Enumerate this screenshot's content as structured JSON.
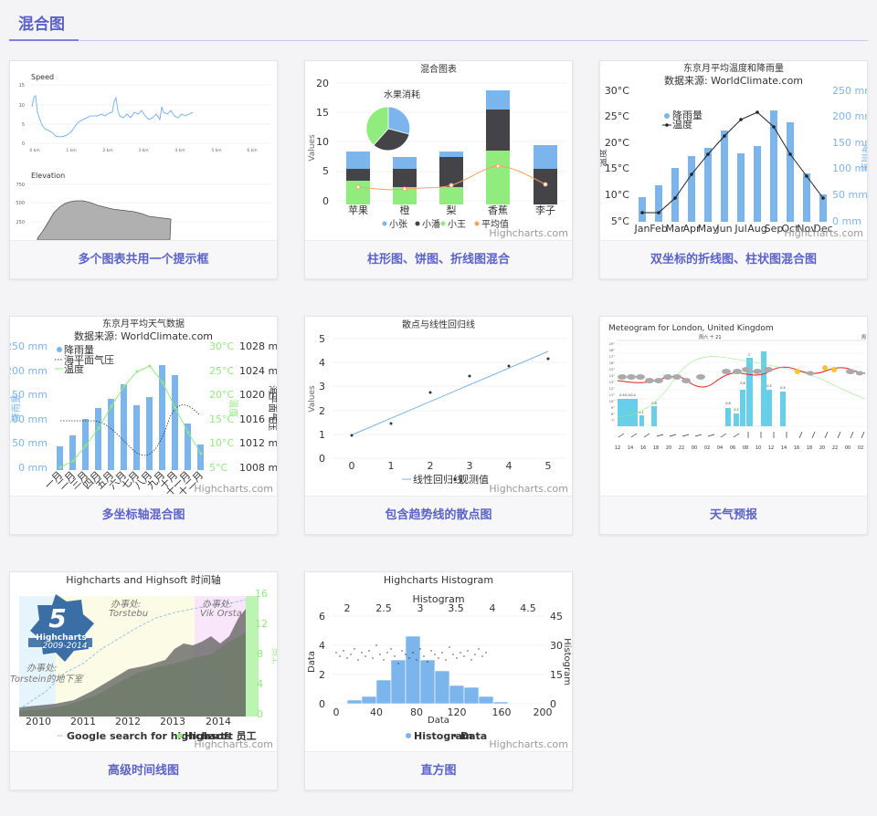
{
  "page": {
    "title": "混合图"
  },
  "colors": {
    "accent": "#5b62c8",
    "blue": "#7cb5ec",
    "dark": "#434348",
    "green": "#90ed7d",
    "orange": "#f7a35c"
  },
  "cards": [
    {
      "caption": "多个图表共用一个提示框",
      "thumb": {
        "speed_title": "Speed",
        "speed_yticks": [
          "15",
          "10",
          "5",
          "0"
        ],
        "elevation_title": "Elevation",
        "elevation_yticks": [
          "750",
          "500",
          "250"
        ],
        "xticks": [
          "0 km",
          "1 km",
          "2 km",
          "3 km",
          "4 km",
          "5 km",
          "6 km"
        ]
      }
    },
    {
      "caption": "柱形图、饼图、折线图混合",
      "thumb": {
        "title": "混合图表",
        "pie_title": "水果消耗",
        "ylabel": "Values",
        "yticks": [
          "20",
          "15",
          "10",
          "5",
          "0"
        ],
        "categories": [
          "苹果",
          "橙",
          "梨",
          "香蕉",
          "李子"
        ],
        "legend": [
          "小张",
          "小潘",
          "小王",
          "平均值"
        ],
        "credit": "Highcharts.com"
      }
    },
    {
      "caption": "双坐标的折线图、柱状图混合图",
      "thumb": {
        "title": "东京月平均温度和降雨量",
        "subtitle": "数据来源: WorldClimate.com",
        "left_ticks": [
          "30°C",
          "25°C",
          "20°C",
          "15°C",
          "10°C",
          "5°C"
        ],
        "right_ticks": [
          "250 mm",
          "200 mm",
          "150 mm",
          "100 mm",
          "50 mm",
          "0 mm"
        ],
        "left_axis_title": "温度",
        "right_axis_title": "降雨量",
        "legend": [
          "降雨量",
          "温度"
        ],
        "months": [
          "Jan",
          "Feb",
          "Mar",
          "Apr",
          "May",
          "Jun",
          "Jul",
          "Aug",
          "Sep",
          "Oct",
          "Nov",
          "Dec"
        ],
        "credit": "Highcharts.com"
      }
    },
    {
      "caption": "多坐标轴混合图",
      "thumb": {
        "title": "东京月平均天气数据",
        "subtitle": "数据来源: WorldClimate.com",
        "left_ticks": [
          "250 mm",
          "200 mm",
          "150 mm",
          "100 mm",
          "50 mm",
          "0 mm"
        ],
        "temp_ticks": [
          "30°C",
          "25°C",
          "20°C",
          "15°C",
          "10°C",
          "5°C"
        ],
        "press_ticks": [
          "1028 m",
          "1024 m",
          "1020 m",
          "1016 m",
          "1012 m",
          "1008 m"
        ],
        "left_axis_title": "降雨量",
        "temp_axis_title": "温度",
        "press_axis_title": "海平面气压",
        "legend": [
          "降雨量",
          "海平面气压",
          "温度"
        ],
        "months": [
          "一月",
          "二月",
          "三月",
          "四月",
          "五月",
          "六月",
          "七月",
          "八月",
          "九月",
          "十月",
          "十一月",
          "十二月"
        ],
        "credit": "Highcharts.com"
      }
    },
    {
      "caption": "包含趋势线的散点图",
      "thumb": {
        "title": "散点与线性回归线",
        "ylabel": "Values",
        "yticks": [
          "5",
          "4",
          "3",
          "2",
          "1",
          "0"
        ],
        "xticks": [
          "0",
          "1",
          "2",
          "3",
          "4",
          "5"
        ],
        "legend": [
          "线性回归线",
          "观测值"
        ],
        "credit": "Highcharts.com"
      }
    },
    {
      "caption": "天气预报",
      "thumb": {
        "title": "Meteogram for London, United Kingdom",
        "day_label": "周六 十 21",
        "day_label_right": "周",
        "hours": [
          "12",
          "14",
          "16",
          "18",
          "20",
          "22",
          "00",
          "02",
          "04",
          "06",
          "08",
          "10",
          "12",
          "14",
          "16",
          "18",
          "20",
          "22",
          "00",
          "02"
        ],
        "temp_ticks": [
          "19°",
          "18°",
          "17°",
          "16°",
          "15°",
          "14°",
          "13°",
          "12°",
          "11°",
          "10°",
          "9°",
          "8°",
          "7°"
        ],
        "precip_labels": [
          "0.4",
          "0.4",
          "0.4",
          "0.1",
          "0.8",
          "0.8",
          "0.2",
          "0.6",
          "1",
          "0.5",
          "0.5"
        ]
      }
    },
    {
      "caption": "高级时间线图",
      "thumb": {
        "title": "Highcharts and Highsoft 时间轴",
        "years": [
          "2010",
          "2011",
          "2012",
          "2013",
          "2014"
        ],
        "right_ticks": [
          "16",
          "12",
          "8",
          "4",
          "0"
        ],
        "right_axis_title": "员工",
        "badge_number": "5",
        "badge_text": "Highcharts",
        "badge_years": "2009-2014",
        "annotations": [
          "办事处:",
          "Torstebu",
          "办事处:",
          "Vik Orsta",
          "办事处:",
          "Torstein的地下室"
        ],
        "legend": [
          "Google search for highcharts",
          "Highsoft 员工"
        ],
        "credit": "Highcharts.com"
      }
    },
    {
      "caption": "直方图",
      "thumb": {
        "title": "Highcharts Histogram",
        "top_axis_title": "Histogram",
        "top_ticks": [
          "2",
          "2.5",
          "3",
          "3.5",
          "4",
          "4.5"
        ],
        "left_ticks": [
          "6",
          "4",
          "2",
          "0"
        ],
        "left_axis_title": "Data",
        "right_ticks": [
          "45",
          "30",
          "15",
          "0"
        ],
        "right_axis_title": "Histogram",
        "bottom_ticks": [
          "0",
          "40",
          "80",
          "120",
          "160",
          "200"
        ],
        "bottom_axis_title": "Data",
        "legend": [
          "Histogram",
          "Data"
        ],
        "credit": "Highcharts.com"
      }
    }
  ]
}
